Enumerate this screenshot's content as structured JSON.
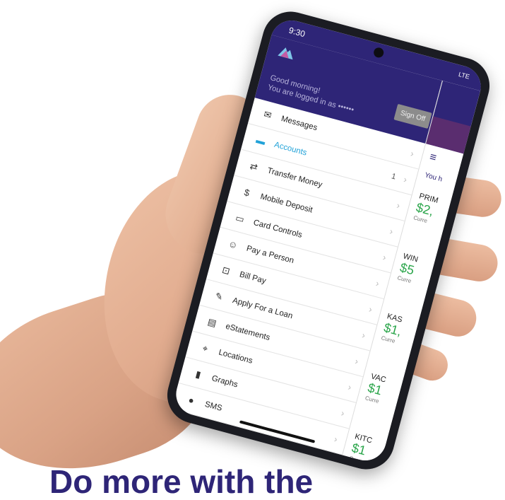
{
  "status": {
    "time": "9:30",
    "network": "LTE"
  },
  "header": {
    "greeting_line1": "Good morning!",
    "greeting_line2": "You are logged in as ••••••",
    "sign_off_label": "Sign Off"
  },
  "menu": {
    "items": [
      {
        "label": "Messages",
        "icon": "envelope-icon",
        "glyph": "✉"
      },
      {
        "label": "Accounts",
        "icon": "wallet-icon",
        "glyph": "▬",
        "badge": "1",
        "active": true
      },
      {
        "label": "Transfer Money",
        "icon": "transfer-icon",
        "glyph": "⇄"
      },
      {
        "label": "Mobile Deposit",
        "icon": "check-deposit-icon",
        "glyph": "$"
      },
      {
        "label": "Card Controls",
        "icon": "card-icon",
        "glyph": "▭"
      },
      {
        "label": "Pay a Person",
        "icon": "people-icon",
        "glyph": "☺"
      },
      {
        "label": "Bill Pay",
        "icon": "bill-icon",
        "glyph": "⊡"
      },
      {
        "label": "Apply For a Loan",
        "icon": "loan-icon",
        "glyph": "✎"
      },
      {
        "label": "eStatements",
        "icon": "statement-icon",
        "glyph": "▤"
      },
      {
        "label": "Locations",
        "icon": "location-pin-icon",
        "glyph": "⌖"
      },
      {
        "label": "Graphs",
        "icon": "bar-graph-icon",
        "glyph": "▮"
      },
      {
        "label": "SMS",
        "icon": "sms-icon",
        "glyph": "●"
      },
      {
        "label": "",
        "icon": "",
        "glyph": ""
      }
    ]
  },
  "accounts_panel": {
    "greeting": "You h",
    "accounts": [
      {
        "name": "PRIM",
        "balance": "$2,",
        "sub": "Curre"
      },
      {
        "name": "WIN",
        "balance": "$5",
        "sub": "Curre"
      },
      {
        "name": "KAS",
        "balance": "$1,",
        "sub": "Curre"
      },
      {
        "name": "VAC",
        "balance": "$1",
        "sub": "Curre"
      },
      {
        "name": "KITC",
        "balance": "$1",
        "sub": "Curr"
      }
    ]
  },
  "headline": "Do more with the",
  "colors": {
    "brand": "#2e2577",
    "accent": "#21a2d8",
    "positive": "#2aa54a"
  }
}
